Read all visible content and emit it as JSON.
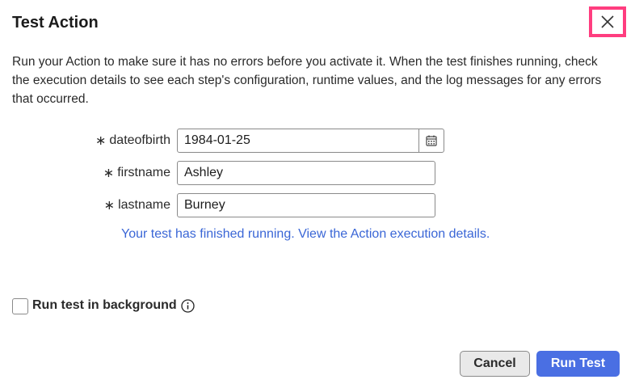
{
  "dialog": {
    "title": "Test Action",
    "description": "Run your Action to make sure it has no errors before you activate it. When the test finishes running, check the execution details to see each step's configuration, runtime values, and the log messages for any errors that occurred."
  },
  "form": {
    "required_marker": "∗",
    "fields": [
      {
        "label": "dateofbirth",
        "value": "1984-01-25"
      },
      {
        "label": "firstname",
        "value": "Ashley"
      },
      {
        "label": "lastname",
        "value": "Burney"
      }
    ]
  },
  "status": {
    "message": "Your test has finished running. View the Action execution details."
  },
  "options": {
    "background_label": "Run test in background",
    "background_checked": false
  },
  "footer": {
    "cancel_label": "Cancel",
    "run_label": "Run Test"
  },
  "icons": {
    "close": "close-icon",
    "calendar": "calendar-icon",
    "info": "info-icon"
  },
  "colors": {
    "primary": "#4a6fe3",
    "link": "#3a66d6",
    "highlight": "#ff3d7f"
  }
}
